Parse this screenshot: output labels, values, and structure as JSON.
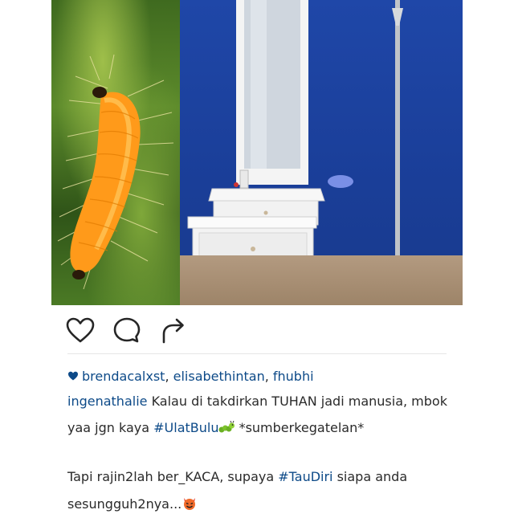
{
  "post": {
    "likes_users": [
      {
        "name": "brendacalxst"
      },
      {
        "name": "elisabethintan"
      },
      {
        "name": "fhubhi"
      }
    ],
    "like_separator": ", ",
    "caption": {
      "author": "ingenathalie",
      "line1_text": " Kalau di takdirkan TUHAN jadi manusia, mbok",
      "line2_text_before": "yaa jgn kaya ",
      "hashtag1": "#UlatBulu",
      "line2_text_after": " *sumberkegatelan*",
      "line3_text_before": "Tapi rajin2lah ber_KACA, supaya ",
      "hashtag2": "#TauDiri",
      "line3_text_after": " siapa anda",
      "line4_text": "sesungguh2nya..."
    }
  },
  "icons": {
    "like": "heart-outline-icon",
    "comment": "speech-bubble-icon",
    "share": "share-arrow-icon",
    "caterpillar_emoji": "caterpillar-emoji",
    "devil_emoji": "smiling-devil-emoji"
  },
  "colors": {
    "link": "#0d4a88",
    "text": "#2a2a2a",
    "wall_blue": "#1c3f9a",
    "caterpillar_orange": "#ff9a1a"
  }
}
